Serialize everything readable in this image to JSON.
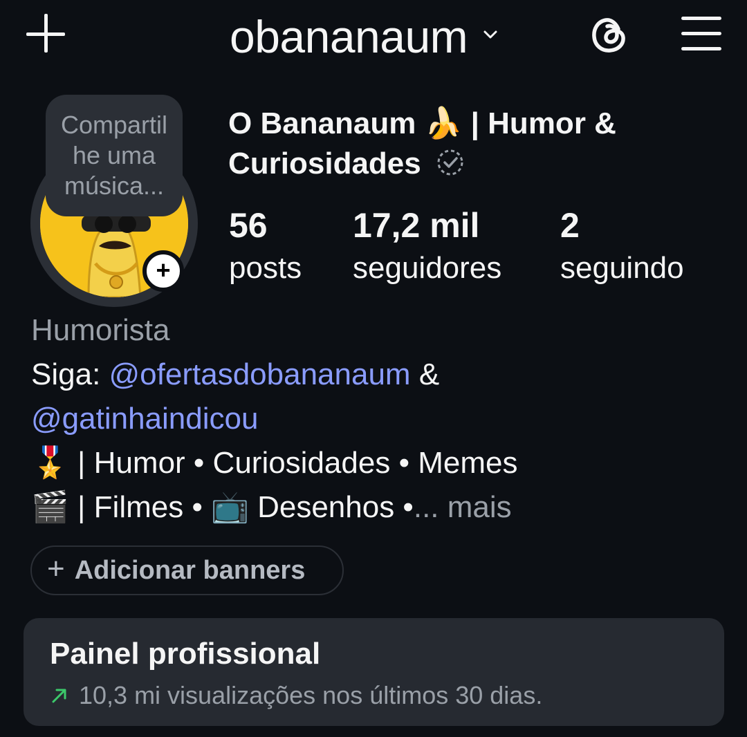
{
  "header": {
    "username": "obananaum",
    "icons": [
      "plus-icon",
      "chevron-down-icon",
      "threads-icon",
      "menu-icon"
    ]
  },
  "profile": {
    "note": "Compartilhe uma música...",
    "display_name": "O Bananaum 🍌 | Humor & Curiosidades",
    "verified": true,
    "stats": [
      {
        "value": "56",
        "label": "posts"
      },
      {
        "value": "17,2 mil",
        "label": "seguidores"
      },
      {
        "value": "2",
        "label": "seguindo"
      }
    ]
  },
  "bio": {
    "category": "Humorista",
    "follow_prefix": "Siga: ",
    "mention1": "@ofertasdobananaum",
    "amp": " &",
    "mention2": "@gatinhaindicou",
    "line3": "🎖️ | Humor • Curiosidades • Memes",
    "line4": "🎬 | Filmes • 📺 Desenhos •",
    "more": "... mais"
  },
  "banners": {
    "label": "Adicionar banners"
  },
  "pro_panel": {
    "title": "Painel profissional",
    "subtitle": "10,3 mi visualizações nos últimos 30 dias.",
    "trend_color": "#3cc96b"
  }
}
